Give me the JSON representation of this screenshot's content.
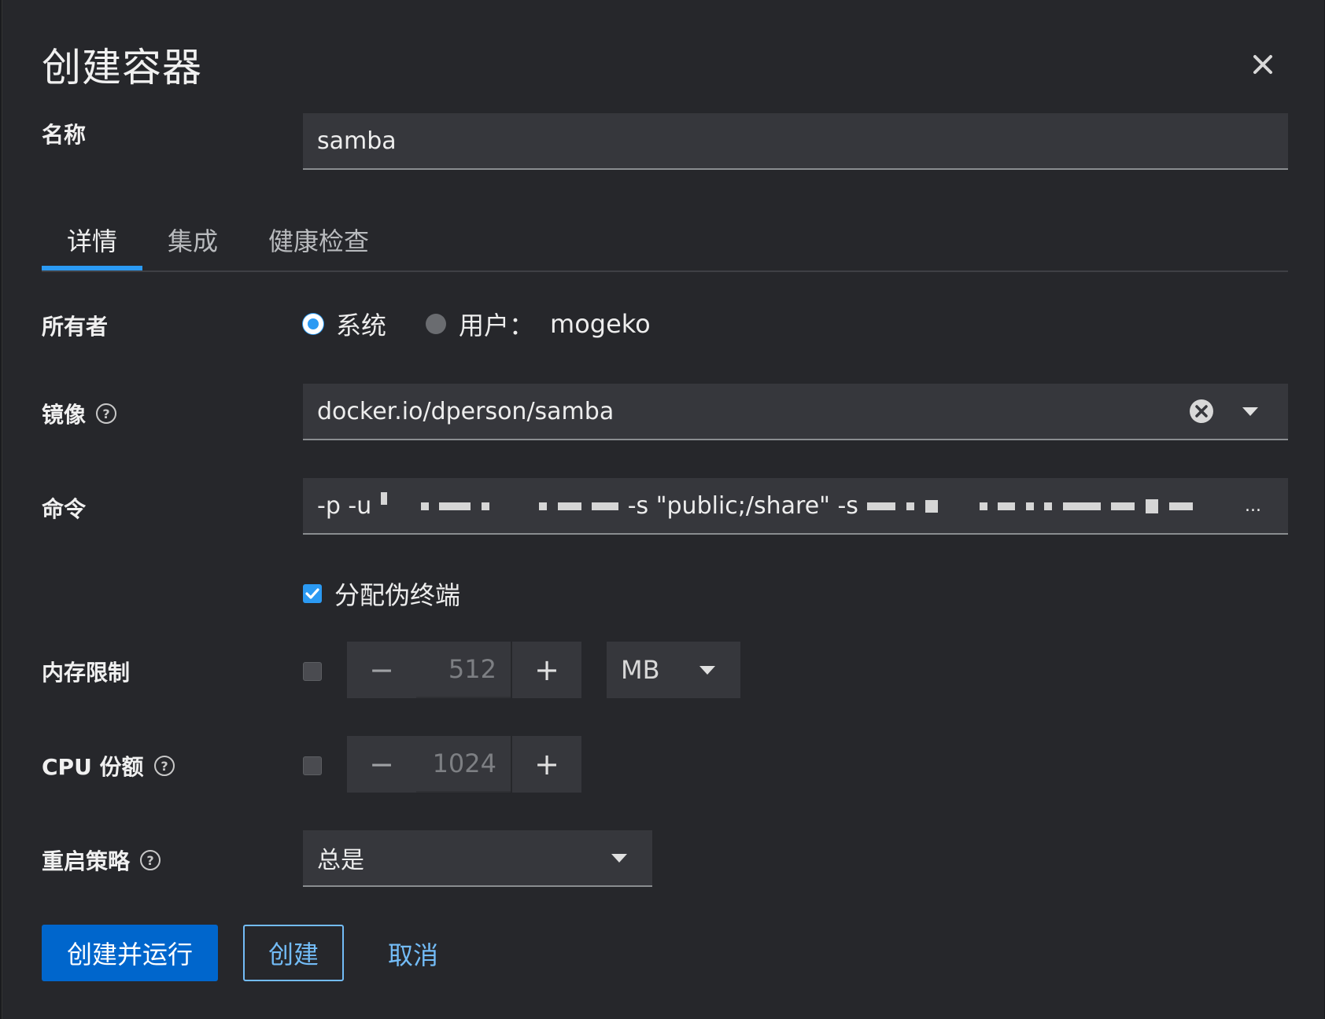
{
  "dialog": {
    "title": "创建容器"
  },
  "name": {
    "label": "名称",
    "value": "samba"
  },
  "tabs": [
    {
      "label": "详情",
      "active": true
    },
    {
      "label": "集成",
      "active": false
    },
    {
      "label": "健康检查",
      "active": false
    }
  ],
  "owner": {
    "label": "所有者",
    "option_system": "系统",
    "option_user": "用户：",
    "user_name": "mogeko",
    "selected": "system"
  },
  "image": {
    "label": "镜像",
    "value": "docker.io/dperson/samba"
  },
  "command": {
    "label": "命令",
    "prefix": "-p -u",
    "middle": "-s \"public;/share\" -s",
    "ellipsis": "..."
  },
  "tty": {
    "label": "分配伪终端",
    "checked": true
  },
  "memory": {
    "label": "内存限制",
    "enabled": false,
    "value": "512",
    "unit": "MB",
    "minus": "−",
    "plus": "+"
  },
  "cpu": {
    "label": "CPU 份额",
    "enabled": false,
    "value": "1024",
    "minus": "−",
    "plus": "+"
  },
  "restart": {
    "label": "重启策略",
    "value": "总是"
  },
  "actions": {
    "create_run": "创建并运行",
    "create": "创建",
    "cancel": "取消"
  },
  "colors": {
    "accent": "#2b9af3",
    "primary_button": "#0066cc",
    "link": "#73bcf7",
    "background": "#26272b",
    "field": "#36373c"
  }
}
